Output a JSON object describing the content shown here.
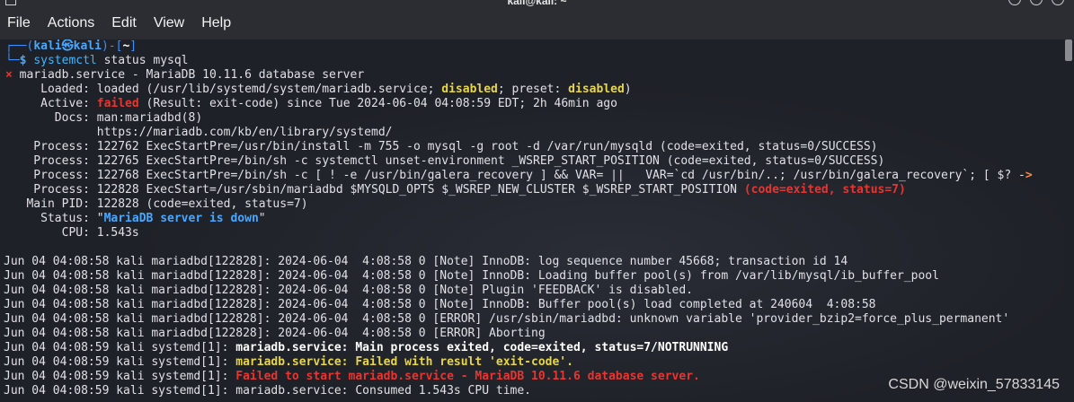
{
  "window": {
    "title": "kali@kali: ~"
  },
  "menu": [
    "File",
    "Actions",
    "Edit",
    "View",
    "Help"
  ],
  "prompt": {
    "open": "┌──(",
    "user": "kali",
    "at": "㉿",
    "host": "kali",
    "mid": ")-[",
    "dir": "~",
    "close": "]",
    "second_prefix": "└─",
    "dollar": "$",
    "command": "systemctl",
    "args": " status mysql"
  },
  "status": {
    "bullet": "×",
    "header": " mariadb.service - MariaDB 10.11.6 database server",
    "loaded_label": "     Loaded: ",
    "loaded_value": "loaded (/usr/lib/systemd/system/mariadb.service; ",
    "loaded_disabled": "disabled",
    "loaded_preset": "; preset: ",
    "loaded_preset_value": "disabled",
    "loaded_end": ")",
    "active_label": "     Active: ",
    "active_state": "failed",
    "active_rest": " (Result: exit-code) since Tue 2024-06-04 04:08:59 EDT; 2h 46min ago",
    "docs_label": "       Docs: ",
    "docs_1": "man:mariadbd(8)",
    "docs_2": "             https://mariadb.com/kb/en/library/systemd/",
    "process_1": "    Process: 122762 ExecStartPre=/usr/bin/install -m 755 -o mysql -g root -d /var/run/mysqld (code=exited, status=0/SUCCESS)",
    "process_2": "    Process: 122765 ExecStartPre=/bin/sh -c systemctl unset-environment _WSREP_START_POSITION (code=exited, status=0/SUCCESS)",
    "process_3": "    Process: 122768 ExecStartPre=/bin/sh -c [ ! -e /usr/bin/galera_recovery ] && VAR= ||   VAR=`cd /usr/bin/..; /usr/bin/galera_recovery`; [ $? -",
    "process_3_arrow": ">",
    "process_4": "    Process: 122828 ExecStart=/usr/sbin/mariadbd $MYSQLD_OPTS $_WSREP_NEW_CLUSTER $_WSREP_START_POSITION ",
    "process_4_result": "(code=exited, status=7)",
    "mainpid": "   Main PID: 122828 (code=exited, status=7)",
    "status_label": "     Status: \"",
    "status_value": "MariaDB server is down",
    "status_end": "\"",
    "cpu": "        CPU: 1.543s"
  },
  "log": [
    "Jun 04 04:08:58 kali mariadbd[122828]: 2024-06-04  4:08:58 0 [Note] InnoDB: log sequence number 45668; transaction id 14",
    "Jun 04 04:08:58 kali mariadbd[122828]: 2024-06-04  4:08:58 0 [Note] InnoDB: Loading buffer pool(s) from /var/lib/mysql/ib_buffer_pool",
    "Jun 04 04:08:58 kali mariadbd[122828]: 2024-06-04  4:08:58 0 [Note] Plugin 'FEEDBACK' is disabled.",
    "Jun 04 04:08:58 kali mariadbd[122828]: 2024-06-04  4:08:58 0 [Note] InnoDB: Buffer pool(s) load completed at 240604  4:08:58",
    "Jun 04 04:08:58 kali mariadbd[122828]: 2024-06-04  4:08:58 0 [ERROR] /usr/sbin/mariadbd: unknown variable 'provider_bzip2=force_plus_permanent'",
    "Jun 04 04:08:58 kali mariadbd[122828]: 2024-06-04  4:08:58 0 [ERROR] Aborting"
  ],
  "systemd_log": {
    "prefix": "Jun 04 04:08:59 kali systemd[1]: ",
    "line1": "mariadb.service: Main process exited, code=exited, status=7/NOTRUNNING",
    "line2": "mariadb.service: Failed with result 'exit-code'.",
    "line3": "Failed to start mariadb.service - MariaDB 10.11.6 database server.",
    "line4": "mariadb.service: Consumed 1.543s CPU time."
  },
  "watermark": "CSDN @weixin_57833145",
  "colors": {
    "background": "#1f2128",
    "menubar": "#2b2d33",
    "prompt_blue": "#3f8fff",
    "error_red": "#e8352f",
    "warning_yellow": "#e7d54a",
    "status_blue": "#47a8ff"
  }
}
